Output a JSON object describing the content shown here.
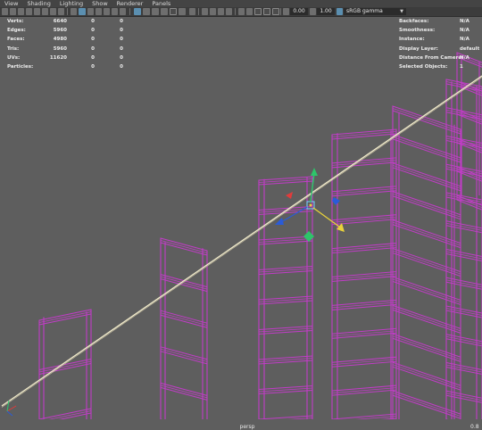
{
  "menu": [
    "View",
    "Shading",
    "Lighting",
    "Show",
    "Renderer",
    "Panels"
  ],
  "toolbar": {
    "exposure": "0.00",
    "gamma": "1.00",
    "color_space": "sRGB gamma"
  },
  "stats": [
    {
      "label": "Verts:",
      "values": [
        "6640",
        "0",
        "0"
      ]
    },
    {
      "label": "Edges:",
      "values": [
        "5960",
        "0",
        "0"
      ]
    },
    {
      "label": "Faces:",
      "values": [
        "4980",
        "0",
        "0"
      ]
    },
    {
      "label": "Tris:",
      "values": [
        "5960",
        "0",
        "0"
      ]
    },
    {
      "label": "UVs:",
      "values": [
        "11620",
        "0",
        "0"
      ]
    },
    {
      "label": "Particles:",
      "values": [
        "",
        "0",
        "0"
      ]
    }
  ],
  "info": [
    {
      "label": "Backfaces:",
      "value": "N/A"
    },
    {
      "label": "Smoothness:",
      "value": "N/A"
    },
    {
      "label": "Instance:",
      "value": "N/A"
    },
    {
      "label": "Display Layer:",
      "value": "default"
    },
    {
      "label": "Distance From Camera:",
      "value": "N/A"
    },
    {
      "label": "Selected Objects:",
      "value": "1"
    }
  ],
  "camera": "persp",
  "fps": "0.8",
  "colors": {
    "viewport_bg": "#5e5e5e",
    "wireframe": "#c23cc8",
    "curve": "#f2eccc",
    "gizmo_x": "#e23b3b",
    "gizmo_y": "#2ec46a",
    "gizmo_z": "#2a5bd8",
    "gizmo_center": "#e8d23a"
  }
}
